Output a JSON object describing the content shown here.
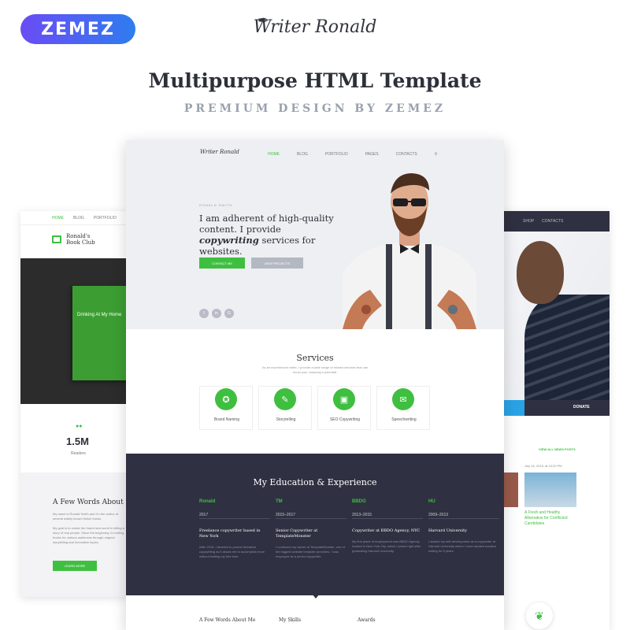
{
  "header": {
    "badge": "ZEMEZ",
    "brand": "Writer Ronald",
    "headline": "Multipurpose HTML Template",
    "subline": "PREMIUM DESIGN BY ZEMEZ"
  },
  "left_mock": {
    "nav": [
      "HOME",
      "BLOG",
      "PORTFOLIO"
    ],
    "logo_line1": "Ronald's",
    "logo_line2": "Book Club",
    "book_title": "Drinking At My Home",
    "stat_value": "1.5M",
    "stat_label": "Readers",
    "words_title": "A Few Words About",
    "para1": "My name is Ronald Smith and I'm the author of several widely known fiction books.",
    "para2": "My goal is to create the brand new world in telling a story of real people. Since the beginning I'm writing books for various audiences through original storytelling and innovative topics.",
    "learn_more": "LEARN MORE"
  },
  "right_mock": {
    "nav": [
      "SHOP",
      "CONTACTS"
    ],
    "donate": "DONATE",
    "view_all": "VIEW ALL NEWS POSTS",
    "date": "July 16, 2016, at 10:20 PM",
    "caption": "A Fresh and Healthy Alternative for Conflicted Candidates"
  },
  "main_mock": {
    "logo": "Writer Ronald",
    "menu": [
      "HOME",
      "BLOG",
      "PORTFOLIO",
      "PAGES",
      "CONTACTS"
    ],
    "author": "RONALD SMITH",
    "hero_text_1": "I am adherent of high-quality content. I provide ",
    "hero_text_em": "copywriting",
    "hero_text_2": " services for websites.",
    "btn_contact": "CONTACT ME",
    "btn_projects": "VIEW PROJECTS",
    "social": [
      "f",
      "in",
      "G"
    ],
    "services_title": "Services",
    "services_sub": "As an experienced writer, I provide a wide range of related services that can boost your company's potential.",
    "services": [
      {
        "label": "Brand Naming",
        "icon": "award-icon"
      },
      {
        "label": "Storytelling",
        "icon": "pencil-icon"
      },
      {
        "label": "SEO Copywriting",
        "icon": "window-icon"
      },
      {
        "label": "Speechwriting",
        "icon": "speech-bubble-icon"
      }
    ],
    "edu_title": "My Education & Experience",
    "timeline": [
      {
        "logo": "Ronald",
        "year": "2017",
        "head": "Freelance copywriter based in New York",
        "body": "After 2016, I decided to pursue freelance copywriting as it allows me to accomplish more without limiting my free time."
      },
      {
        "logo": "TM",
        "year": "2015–2017",
        "head": "Senior Copywriter at TemplateMonster",
        "body": "I continued my career at TemplateMonster, one of the biggest website template providers. I was employed as a senior copywriter."
      },
      {
        "logo": "BBDO",
        "year": "2013–2015",
        "head": "Copywriter at BBDO Agency, NYC",
        "body": "My first place of employment was BBDO Agency located in New York City, which I joined right after graduating Harvard University."
      },
      {
        "logo": "HU",
        "year": "2009–2013",
        "head": "Harvard University",
        "body": "I started my self-development as a copywriter at Harvard University where I have studied creative writing for 5 years."
      }
    ],
    "bottom": [
      "A Few Words About Me",
      "My Skills",
      "Awards"
    ]
  },
  "colors": {
    "accent": "#3fbf3f",
    "dark": "#2f3142",
    "badge_start": "#6a4cf5",
    "badge_end": "#2f7cf0"
  }
}
